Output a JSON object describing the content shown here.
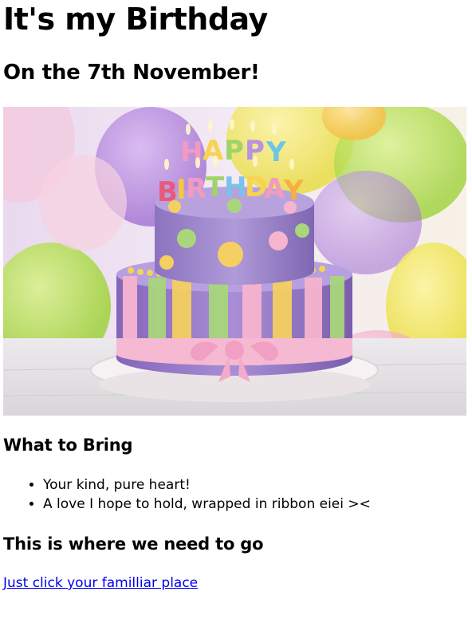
{
  "heading": "It's my Birthday",
  "date_heading": "On the 7th November!",
  "cake_image": {
    "candle_letters_top": [
      "H",
      "A",
      "P",
      "P",
      "Y"
    ],
    "candle_letters_bottom": [
      "B",
      "I",
      "R",
      "T",
      "H",
      "D",
      "A",
      "Y"
    ],
    "colors": {
      "top_tier": "#a88fd1",
      "bottom_tier": "#9d7fcc",
      "stripe_yellow": "#f5cf62",
      "stripe_pink": "#f6b4cf",
      "stripe_green": "#a9d67b",
      "ribbon": "#f5b9d2",
      "board": "#f4eff0"
    }
  },
  "bring_section": {
    "title": "What to Bring",
    "items": [
      "Your kind, pure heart!",
      "A love I hope to hold, wrapped in ribbon eiei ><"
    ]
  },
  "where_section": {
    "title": "This is where we need to go",
    "link_text": "Just click your familliar place"
  }
}
